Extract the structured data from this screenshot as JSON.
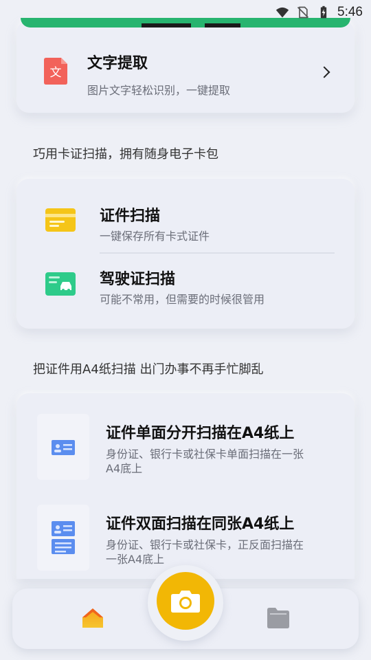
{
  "status_bar": {
    "time": "5:46"
  },
  "text_extract": {
    "title": "文字提取",
    "subtitle": "图片文字轻松识别，一键提取",
    "icon_char": "文"
  },
  "card_section": {
    "heading": "巧用卡证扫描，拥有随身电子卡包",
    "items": [
      {
        "title": "证件扫描",
        "subtitle": "一键保存所有卡式证件"
      },
      {
        "title": "驾驶证扫描",
        "subtitle": "可能不常用，但需要的时候很管用"
      }
    ]
  },
  "a4_section": {
    "heading": "把证件用A4纸扫描 出门办事不再手忙脚乱",
    "items": [
      {
        "title": "证件单面分开扫描在A4纸上",
        "subtitle_line1": "身份证、银行卡或社保卡单面扫描在一张",
        "subtitle_line2": "A4底上"
      },
      {
        "title": "证件双面扫描在同张A4纸上",
        "subtitle_line1": "身份证、银行卡或社保卡，正反面扫描在",
        "subtitle_line2": "一张A4底上"
      }
    ]
  },
  "bottom_nav": {
    "home": "home-icon",
    "camera": "camera-icon",
    "files": "folder-icon"
  },
  "colors": {
    "accent_yellow": "#f2b705",
    "green": "#27b46f",
    "red_icon": "#f2625a",
    "blue_icon": "#5b8def"
  }
}
